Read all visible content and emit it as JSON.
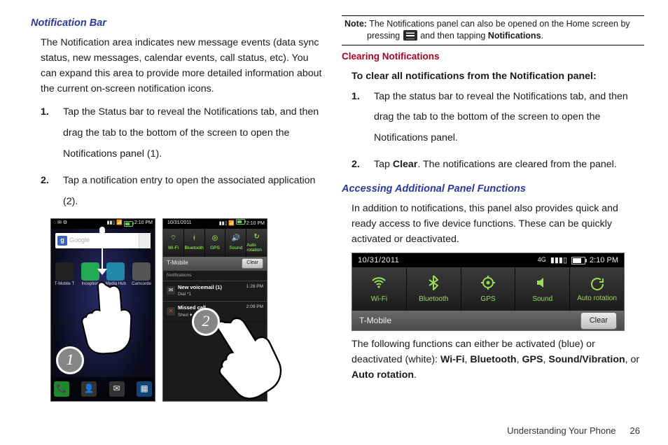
{
  "left": {
    "heading": "Notification Bar",
    "intro": "The Notification area indicates new message events (data sync status, new messages, calendar events, call status, etc). You can expand this area to provide more detailed information about the current on-screen notification icons.",
    "steps": [
      {
        "num": "1.",
        "text": "Tap the Status bar to reveal the Notifications tab, and then drag the tab to the bottom of the screen to open the Notifications panel (1)."
      },
      {
        "num": "2.",
        "text": "Tap a notification entry to open the associated application (2)."
      }
    ],
    "phone1": {
      "time": "2:10 PM",
      "search_placeholder": "Google",
      "apps": [
        "T-Mobile T",
        "Inception",
        "Media Hub",
        "Camcorde"
      ],
      "callout": "1"
    },
    "phone2": {
      "date": "10/31/2011",
      "time": "2:10 PM",
      "quick": [
        "Wi-Fi",
        "Bluetooth",
        "GPS",
        "Sound",
        "Auto rotation"
      ],
      "carrier": "T-Mobile",
      "clear": "Clear",
      "notif_hdr": "Notifications",
      "notifs": [
        {
          "title": "New voicemail (1)",
          "sub": "Dial *1",
          "time": "1:28 PM"
        },
        {
          "title": "Missed call",
          "sub": "Sheri",
          "time": "2:09 PM"
        }
      ],
      "callout": "2"
    }
  },
  "right": {
    "note_label": "Note:",
    "note_text_a": "The Notifications panel can also be opened on the Home screen by pressing ",
    "note_text_b": " and then tapping ",
    "note_bold": "Notifications",
    "note_text_c": ".",
    "clearing_heading": "Clearing Notifications",
    "clearing_lead": "To clear all notifications from the Notification panel:",
    "clearing_steps": [
      {
        "num": "1.",
        "text": "Tap the status bar to reveal the Notifications tab, and then drag the tab to the bottom of the screen to open the Notifications panel."
      },
      {
        "num": "2.",
        "text_a": "Tap ",
        "bold": "Clear",
        "text_b": ". The notifications are cleared from the panel."
      }
    ],
    "access_heading": "Accessing Additional Panel Functions",
    "access_body": "In addition to notifications, this panel also provides quick and ready access to five device functions. These can be quickly activated or deactivated.",
    "panel": {
      "date": "10/31/2011",
      "time": "2:10 PM",
      "quick": [
        {
          "label": "Wi-Fi"
        },
        {
          "label": "Bluetooth"
        },
        {
          "label": "GPS"
        },
        {
          "label": "Sound"
        },
        {
          "label": "Auto rotation"
        }
      ],
      "carrier": "T-Mobile",
      "clear": "Clear"
    },
    "tail_a": "The following functions can either be activated (blue) or deactivated (white): ",
    "tail_items": [
      "Wi-Fi",
      "Bluetooth",
      "GPS",
      "Sound/Vibration",
      "Auto rotation"
    ],
    "tail_sep": ", ",
    "tail_or": ", or ",
    "tail_end": "."
  },
  "footer": {
    "section": "Understanding Your Phone",
    "page": "26"
  }
}
